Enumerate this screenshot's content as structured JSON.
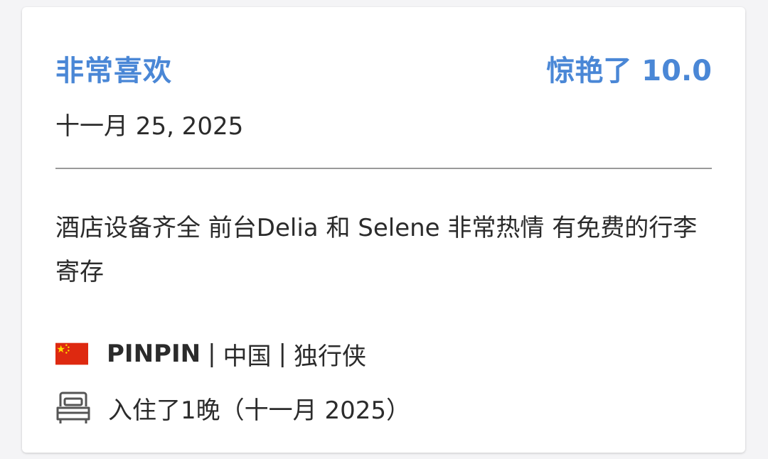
{
  "review": {
    "title": "非常喜欢",
    "rating_label": "惊艳了",
    "rating_score": "10.0",
    "date": "十一月 25, 2025",
    "body": "酒店设备齐全 前台Delia 和 Selene 非常热情 有免费的行李寄存"
  },
  "reviewer": {
    "flag_icon": "china-flag-icon",
    "name": "PINPIN",
    "separator": "|",
    "country": "中国",
    "traveler_type": "独行侠"
  },
  "stay": {
    "icon": "bed-icon",
    "text": "入住了1晚（十一月 2025）"
  },
  "colors": {
    "accent": "#4a87d6",
    "text": "#2b2b2b",
    "divider": "#9a9a9a",
    "flag_red": "#de2910",
    "flag_yellow": "#ffde00"
  }
}
